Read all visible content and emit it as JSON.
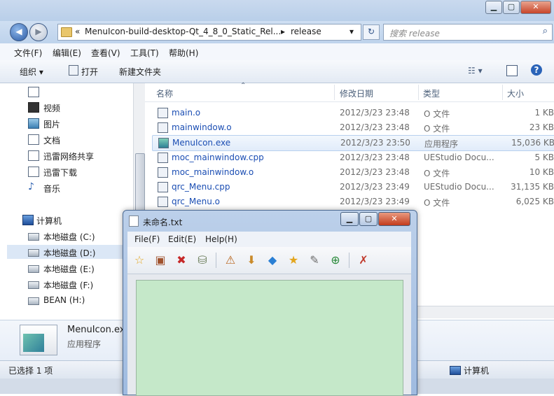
{
  "explorer": {
    "address_parts": [
      "«",
      "MenuIcon-build-desktop-Qt_4_8_0_Static_Rel...",
      "▸",
      "release"
    ],
    "search_placeholder": "搜索 release",
    "menu": [
      "文件(F)",
      "编辑(E)",
      "查看(V)",
      "工具(T)",
      "帮助(H)"
    ],
    "toolbar": {
      "organize": "组织 ▾",
      "open": "打开",
      "new_folder": "新建文件夹"
    },
    "nav": {
      "items": [
        {
          "label": "视频"
        },
        {
          "label": "图片"
        },
        {
          "label": "文档"
        },
        {
          "label": "迅雷网络共享"
        },
        {
          "label": "迅雷下载"
        },
        {
          "label": "音乐"
        },
        {
          "label": "计算机"
        },
        {
          "label": "本地磁盘 (C:)"
        },
        {
          "label": "本地磁盘 (D:)"
        },
        {
          "label": "本地磁盘 (E:)"
        },
        {
          "label": "本地磁盘 (F:)"
        },
        {
          "label": "BEAN (H:)"
        }
      ]
    },
    "columns": {
      "name": "名称",
      "date": "修改日期",
      "type": "类型",
      "size": "大小"
    },
    "files": [
      {
        "name": "main.o",
        "date": "2012/3/23 23:48",
        "type": "O 文件",
        "size": "1 KB"
      },
      {
        "name": "mainwindow.o",
        "date": "2012/3/23 23:48",
        "type": "O 文件",
        "size": "23 KB"
      },
      {
        "name": "MenuIcon.exe",
        "date": "2012/3/23 23:50",
        "type": "应用程序",
        "size": "15,036 KB"
      },
      {
        "name": "moc_mainwindow.cpp",
        "date": "2012/3/23 23:48",
        "type": "UEStudio Docu...",
        "size": "5 KB"
      },
      {
        "name": "moc_mainwindow.o",
        "date": "2012/3/23 23:48",
        "type": "O 文件",
        "size": "10 KB"
      },
      {
        "name": "qrc_Menu.cpp",
        "date": "2012/3/23 23:49",
        "type": "UEStudio Docu...",
        "size": "31,135 KB"
      },
      {
        "name": "qrc_Menu.o",
        "date": "2012/3/23 23:49",
        "type": "O 文件",
        "size": "6,025 KB"
      }
    ],
    "details": {
      "name": "MenuIcon.ex",
      "type": "应用程序"
    },
    "status": {
      "selected": "已选择 1 项",
      "location": "计算机"
    }
  },
  "app": {
    "title": "未命名.txt",
    "menu": [
      "File(F)",
      "Edit(E)",
      "Help(H)"
    ],
    "toolbar_icons": [
      "star-icon",
      "box-icon",
      "delete-icon",
      "database-down-icon",
      "box-warning-icon",
      "box-down-icon",
      "shapes-icon",
      "star-icon",
      "edit-note-icon",
      "zoom-add-icon",
      "erase-icon"
    ]
  }
}
